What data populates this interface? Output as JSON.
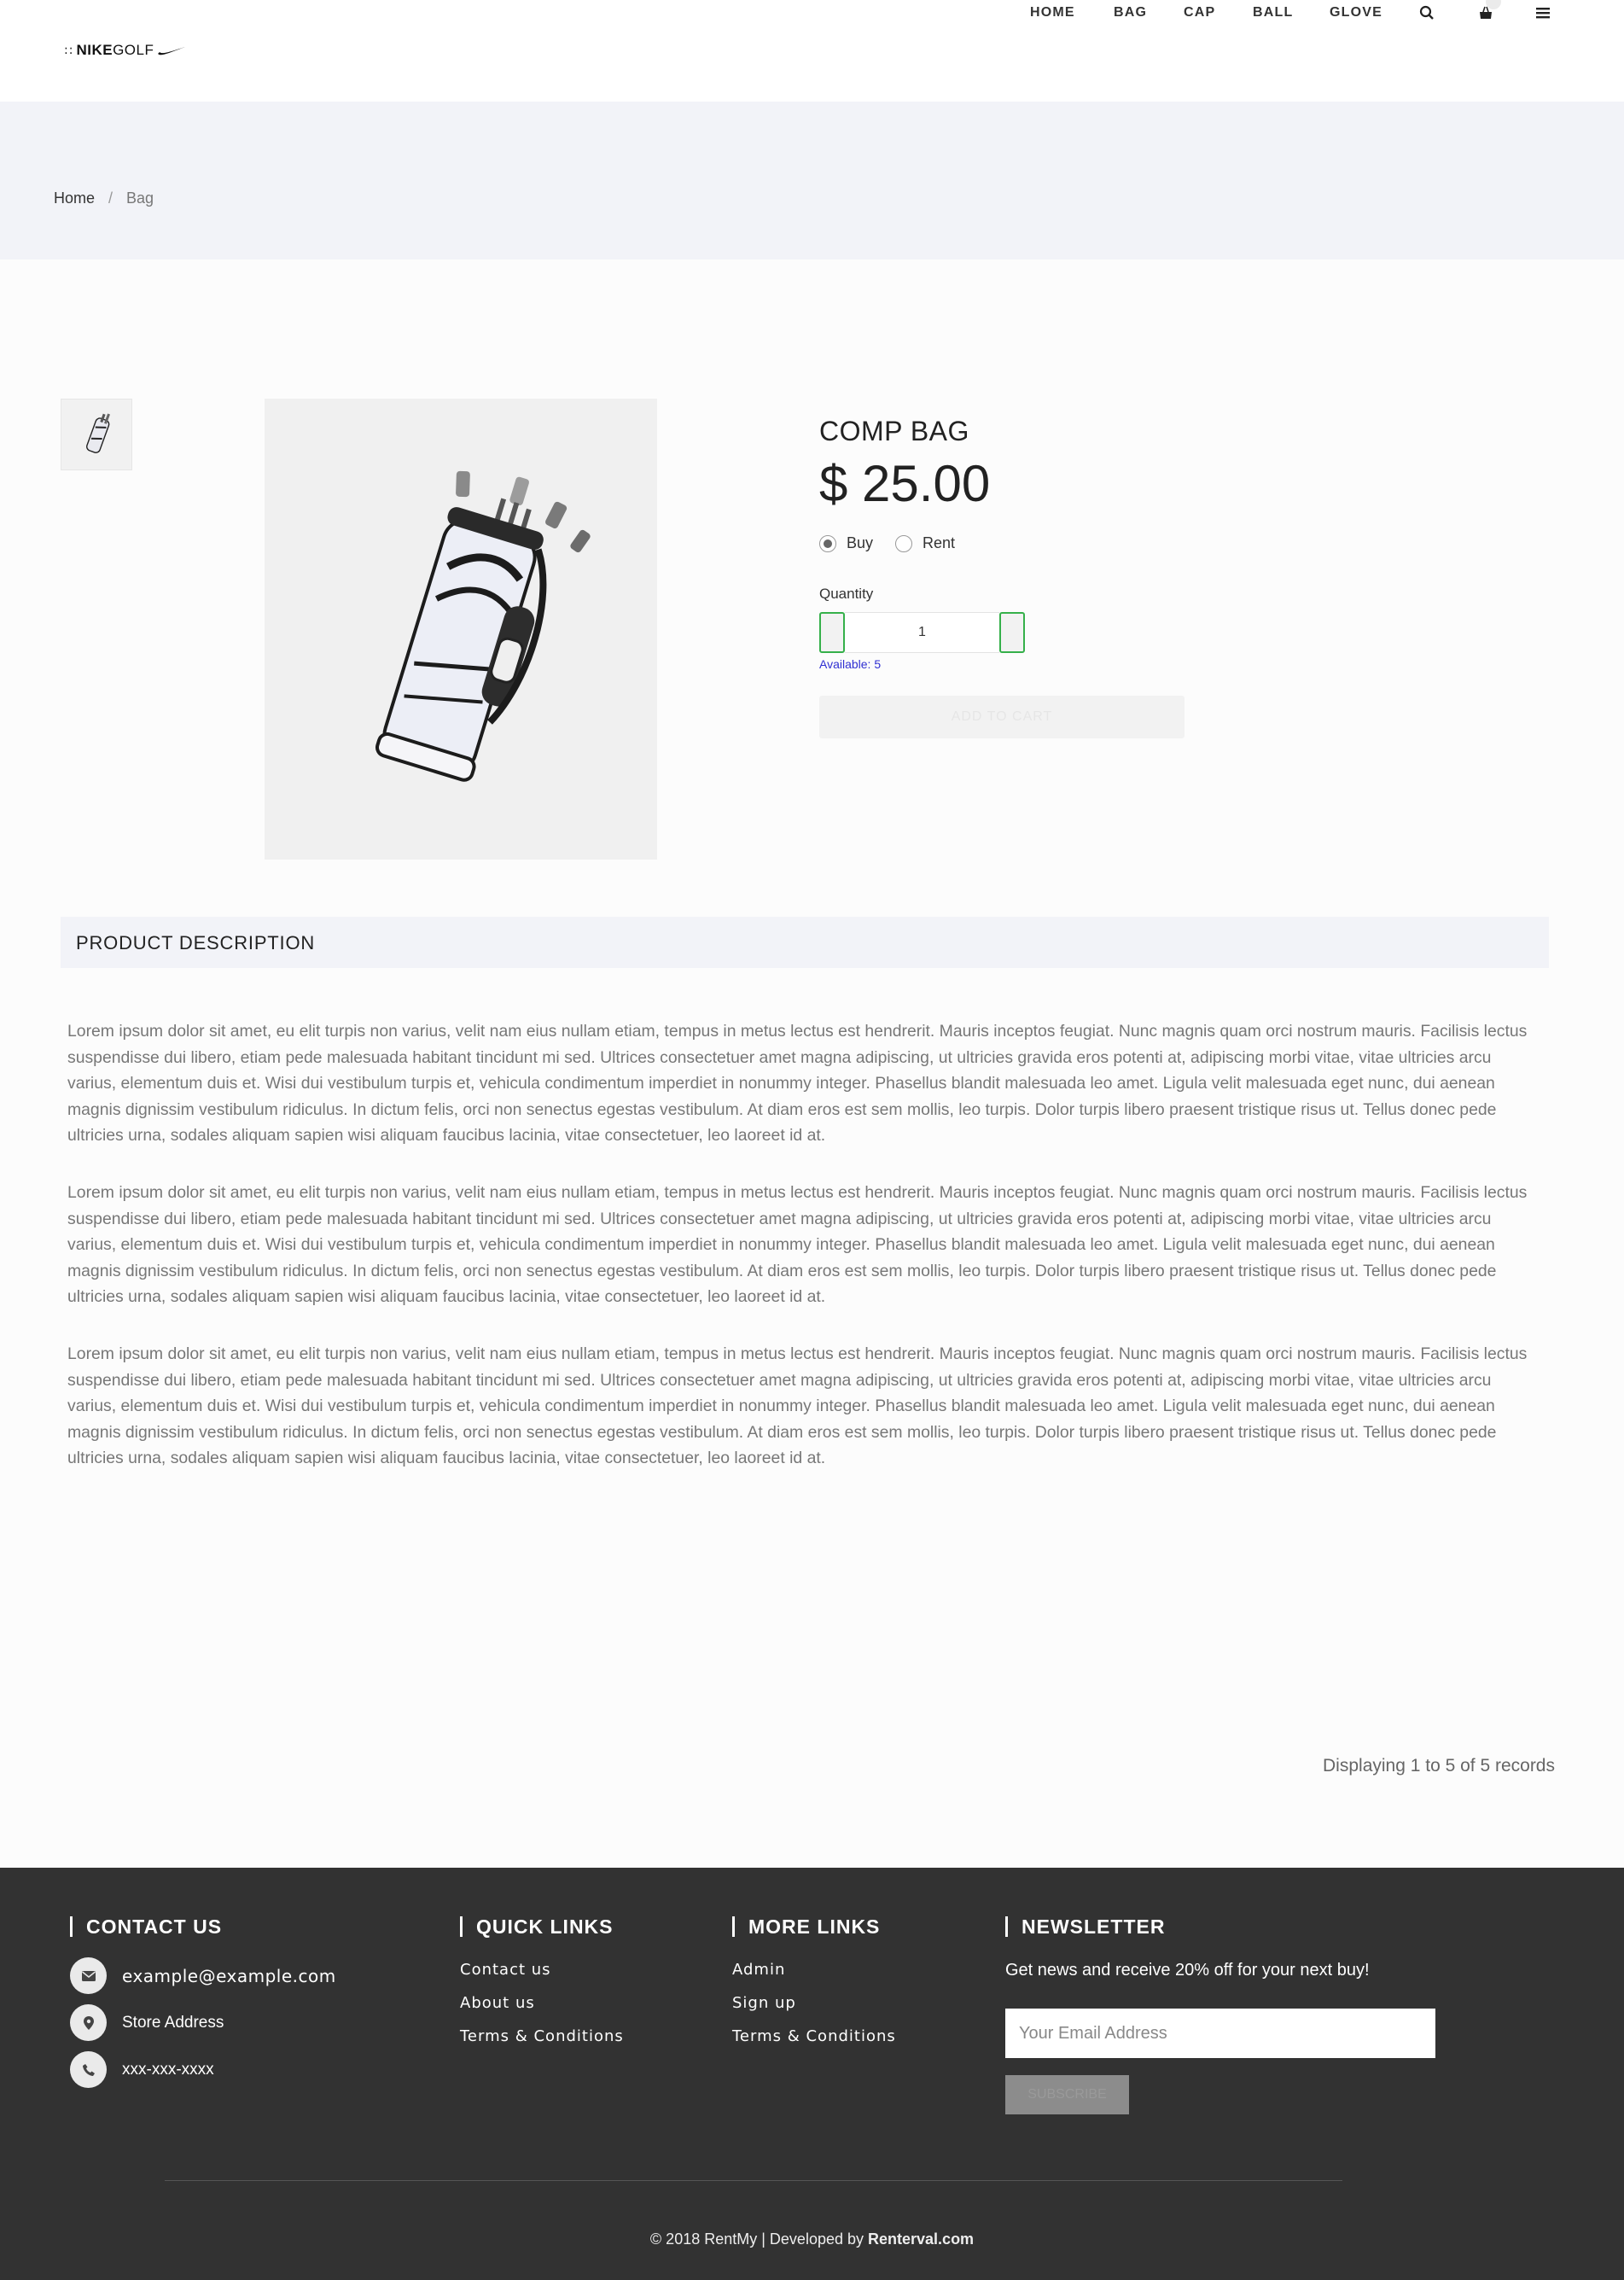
{
  "header": {
    "logo": {
      "dots": "::",
      "brand_bold": "NIKE",
      "brand_thin": "GOLF"
    },
    "nav": [
      {
        "label": "HOME"
      },
      {
        "label": "BAG"
      },
      {
        "label": "CAP"
      },
      {
        "label": "BALL"
      },
      {
        "label": "GLOVE"
      }
    ],
    "icons": [
      "search-icon",
      "cart-icon",
      "menu-icon"
    ]
  },
  "breadcrumb": {
    "home": "Home",
    "separator": "/",
    "current": "Bag"
  },
  "product": {
    "title": "COMP BAG",
    "price": "$ 25.00",
    "options": {
      "buy": "Buy",
      "rent": "Rent",
      "selected": "Buy"
    },
    "quantity_label": "Quantity",
    "quantity_value": "1",
    "available": "Available: 5",
    "add_to_cart": "ADD TO CART"
  },
  "description": {
    "heading": "PRODUCT DESCRIPTION",
    "paragraphs": [
      "Lorem ipsum dolor sit amet, eu elit turpis non varius, velit nam eius nullam etiam, tempus in metus lectus est hendrerit. Mauris inceptos feugiat. Nunc magnis quam orci nostrum mauris. Facilisis lectus suspendisse dui libero, etiam pede malesuada habitant tincidunt mi sed. Ultrices consectetuer amet magna adipiscing, ut ultricies gravida eros potenti at, adipiscing morbi vitae, vitae ultricies arcu varius, elementum duis et. Wisi dui vestibulum turpis et, vehicula condimentum imperdiet in nonummy integer. Phasellus blandit malesuada leo amet. Ligula velit malesuada eget nunc, dui aenean magnis dignissim vestibulum ridiculus. In dictum felis, orci non senectus egestas vestibulum. At diam eros est sem mollis, leo turpis. Dolor turpis libero praesent tristique risus ut. Tellus donec pede ultricies urna, sodales aliquam sapien wisi aliquam faucibus lacinia, vitae consectetuer, leo laoreet id at.",
      "Lorem ipsum dolor sit amet, eu elit turpis non varius, velit nam eius nullam etiam, tempus in metus lectus est hendrerit. Mauris inceptos feugiat. Nunc magnis quam orci nostrum mauris. Facilisis lectus suspendisse dui libero, etiam pede malesuada habitant tincidunt mi sed. Ultrices consectetuer amet magna adipiscing, ut ultricies gravida eros potenti at, adipiscing morbi vitae, vitae ultricies arcu varius, elementum duis et. Wisi dui vestibulum turpis et, vehicula condimentum imperdiet in nonummy integer. Phasellus blandit malesuada leo amet. Ligula velit malesuada eget nunc, dui aenean magnis dignissim vestibulum ridiculus. In dictum felis, orci non senectus egestas vestibulum. At diam eros est sem mollis, leo turpis. Dolor turpis libero praesent tristique risus ut. Tellus donec pede ultricies urna, sodales aliquam sapien wisi aliquam faucibus lacinia, vitae consectetuer, leo laoreet id at.",
      "Lorem ipsum dolor sit amet, eu elit turpis non varius, velit nam eius nullam etiam, tempus in metus lectus est hendrerit. Mauris inceptos feugiat. Nunc magnis quam orci nostrum mauris. Facilisis lectus suspendisse dui libero, etiam pede malesuada habitant tincidunt mi sed. Ultrices consectetuer amet magna adipiscing, ut ultricies gravida eros potenti at, adipiscing morbi vitae, vitae ultricies arcu varius, elementum duis et. Wisi dui vestibulum turpis et, vehicula condimentum imperdiet in nonummy integer. Phasellus blandit malesuada leo amet. Ligula velit malesuada eget nunc, dui aenean magnis dignissim vestibulum ridiculus. In dictum felis, orci non senectus egestas vestibulum. At diam eros est sem mollis, leo turpis. Dolor turpis libero praesent tristique risus ut. Tellus donec pede ultricies urna, sodales aliquam sapien wisi aliquam faucibus lacinia, vitae consectetuer, leo laoreet id at."
    ]
  },
  "records": "Displaying 1 to 5 of 5 records",
  "footer": {
    "contact": {
      "heading": "CONTACT US",
      "email": "example@example.com",
      "address": "Store Address",
      "phone": "xxx-xxx-xxxx"
    },
    "quick_links": {
      "heading": "QUICK LINKS",
      "items": [
        "Contact us",
        "About us",
        "Terms & Conditions"
      ]
    },
    "more_links": {
      "heading": "MORE LINKS",
      "items": [
        "Admin",
        "Sign up",
        "Terms & Conditions"
      ]
    },
    "newsletter": {
      "heading": "NEWSLETTER",
      "text": "Get news and receive 20% off for your next buy!",
      "placeholder": "Your Email Address",
      "button": "SUBSCRIBE"
    },
    "copyright_prefix": "© 2018 RentMy | Developed by",
    "copyright_brand": "Renterval.com"
  },
  "colors": {
    "accent_green": "#35b04a",
    "available_blue": "#2f2fd2",
    "footer_bg": "#323232",
    "band_bg": "#f2f3f8"
  }
}
